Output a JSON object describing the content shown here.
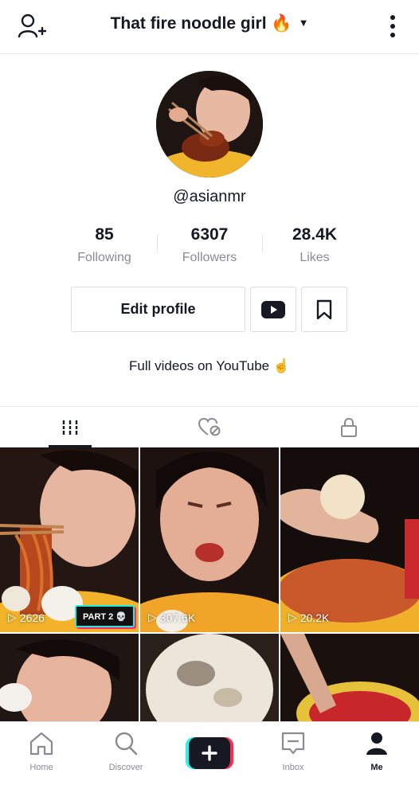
{
  "header": {
    "title": "That fire noodle girl 🔥",
    "caret": "▼",
    "add_user_icon": "add-user-icon",
    "more_icon": "more-vertical-icon"
  },
  "profile": {
    "handle": "@asianmr",
    "stats": [
      {
        "value": "85",
        "label": "Following"
      },
      {
        "value": "6307",
        "label": "Followers"
      },
      {
        "value": "28.4K",
        "label": "Likes"
      }
    ],
    "edit_label": "Edit profile",
    "bio": "Full videos on YouTube ☝"
  },
  "tabs": [
    {
      "icon": "grid-icon",
      "active": true
    },
    {
      "icon": "liked-private-icon",
      "active": false
    },
    {
      "icon": "lock-icon",
      "active": false
    }
  ],
  "videos": [
    {
      "views": "2626",
      "badge": "PART 2 💀"
    },
    {
      "views": "307.6K"
    },
    {
      "views": "20.2K"
    },
    {
      "views": ""
    },
    {
      "views": ""
    },
    {
      "views": ""
    }
  ],
  "nav": [
    {
      "label": "Home"
    },
    {
      "label": "Discover"
    },
    {
      "label": "Inbox"
    },
    {
      "label": "Me"
    }
  ],
  "colors": {
    "text": "#161823",
    "muted": "#8a8b91",
    "accent_cyan": "#25f4ee",
    "accent_pink": "#fe2c55"
  }
}
